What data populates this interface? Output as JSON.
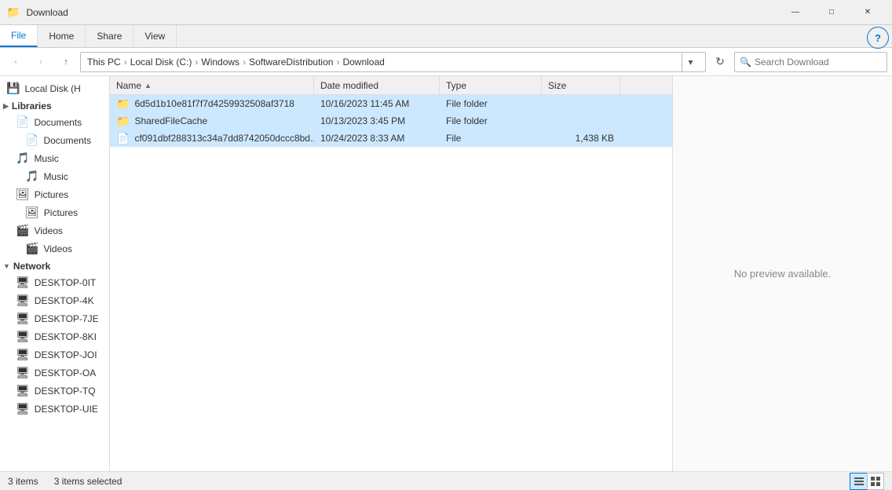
{
  "titleBar": {
    "title": "Download",
    "icon": "📁",
    "controls": {
      "minimize": "—",
      "maximize": "□",
      "close": "✕"
    }
  },
  "ribbon": {
    "tabs": [
      "File",
      "Home",
      "Share",
      "View"
    ],
    "activeTab": "File"
  },
  "addressBar": {
    "back": "‹",
    "forward": "›",
    "up": "↑",
    "pathParts": [
      "This PC",
      "Local Disk (C:)",
      "Windows",
      "SoftwareDistribution",
      "Download"
    ],
    "refresh": "↻",
    "searchPlaceholder": "Search Download"
  },
  "sidebar": {
    "localDiskLabel": "Local Disk (H",
    "sections": {
      "libraries": "Libraries",
      "documents": "Documents",
      "music": "Music",
      "pictures": "Pictures",
      "videos": "Videos",
      "network": "Network"
    },
    "subItems": {
      "documents": "Documents",
      "music": "Music",
      "pictures": "Pictures",
      "videos": "Videos"
    },
    "networkItems": [
      "DESKTOP-0IT",
      "DESKTOP-4K",
      "DESKTOP-7JE",
      "DESKTOP-8KI",
      "DESKTOP-JOI",
      "DESKTOP-OA",
      "DESKTOP-TQ",
      "DESKTOP-UIE"
    ]
  },
  "fileList": {
    "columns": {
      "name": "Name",
      "modified": "Date modified",
      "type": "Type",
      "size": "Size"
    },
    "sortColumn": "Name",
    "sortDirection": "asc",
    "files": [
      {
        "name": "6d5d1b10e81f7f7d4259932508af3718",
        "modified": "10/16/2023 11:45 AM",
        "type": "File folder",
        "size": "",
        "isFolder": true,
        "selected": true
      },
      {
        "name": "SharedFileCache",
        "modified": "10/13/2023 3:45 PM",
        "type": "File folder",
        "size": "",
        "isFolder": true,
        "selected": true
      },
      {
        "name": "cf091dbf288313c34a7dd8742050dccc8bd...",
        "modified": "10/24/2023 8:33 AM",
        "type": "File",
        "size": "1,438 KB",
        "isFolder": false,
        "selected": true
      }
    ]
  },
  "preview": {
    "noPreviewText": "No preview available."
  },
  "statusBar": {
    "itemCount": "3 items",
    "selectedCount": "3 items selected"
  },
  "help": "?"
}
